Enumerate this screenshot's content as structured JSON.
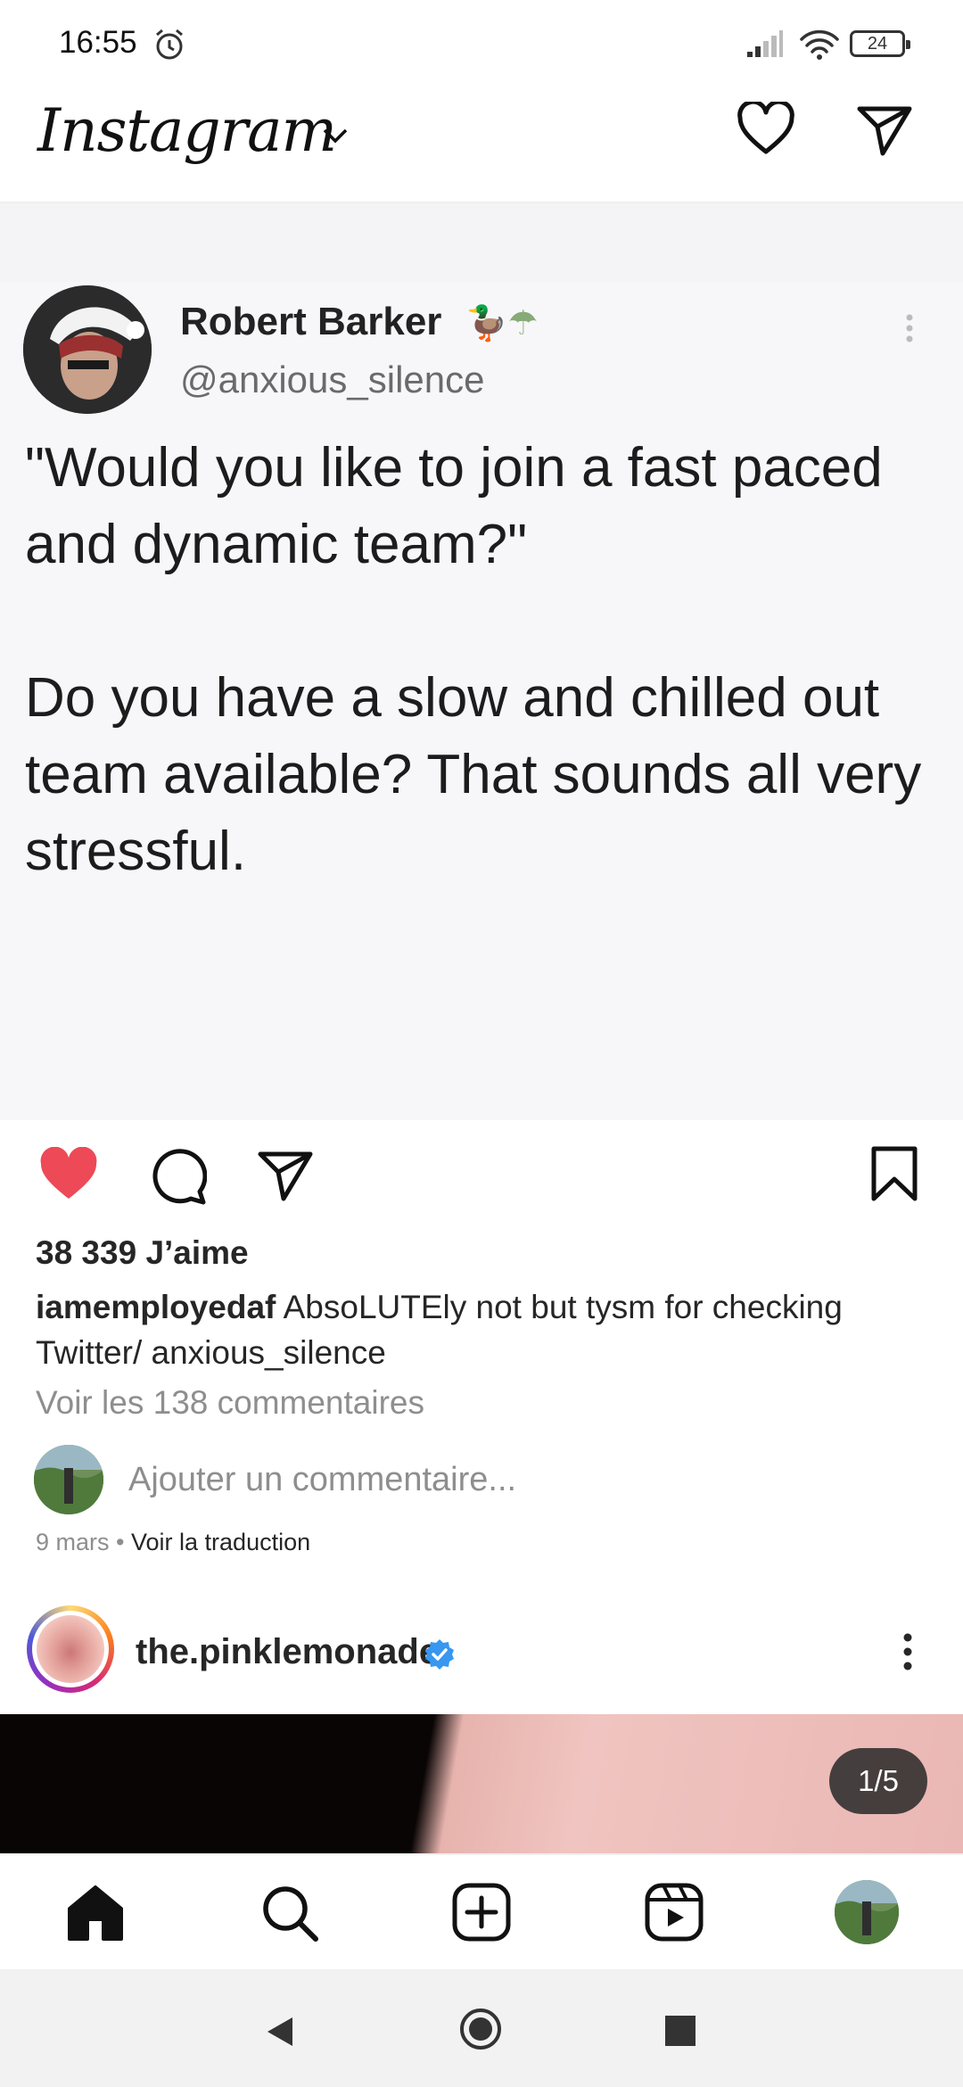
{
  "status_bar": {
    "time": "16:55",
    "battery": "24"
  },
  "header": {
    "logo": "Instagram",
    "icons": [
      "heart-icon",
      "send-icon"
    ]
  },
  "post": {
    "tweet": {
      "author_name": "Robert Barker",
      "author_emoji": "🦆☂",
      "handle": "@anxious_silence",
      "text": "\"Would you like to join a fast paced and dynamic team?\"\n\nDo you have a slow and chilled out team available? That sounds all very stressful."
    },
    "likes": "38 339 J’aime",
    "caption_user": "iamemployedaf",
    "caption_text": " AbsoLUTEly not but tysm for checking Twitter/ anxious_silence",
    "view_comments": "Voir les 138 commentaires",
    "add_comment_placeholder": "Ajouter un commentaire...",
    "date": "9 mars",
    "date_sep": " • ",
    "translate": "Voir la traduction",
    "liked_color": "#ed4956"
  },
  "next_post": {
    "username": "the.pinklemonade",
    "verified_color": "#3897f0",
    "image_counter": "1/5"
  },
  "bottom_nav": [
    "home-icon",
    "search-icon",
    "add-icon",
    "reels-icon",
    "profile-avatar"
  ],
  "system_nav": [
    "back-icon",
    "home-circle-icon",
    "recent-apps-icon"
  ]
}
